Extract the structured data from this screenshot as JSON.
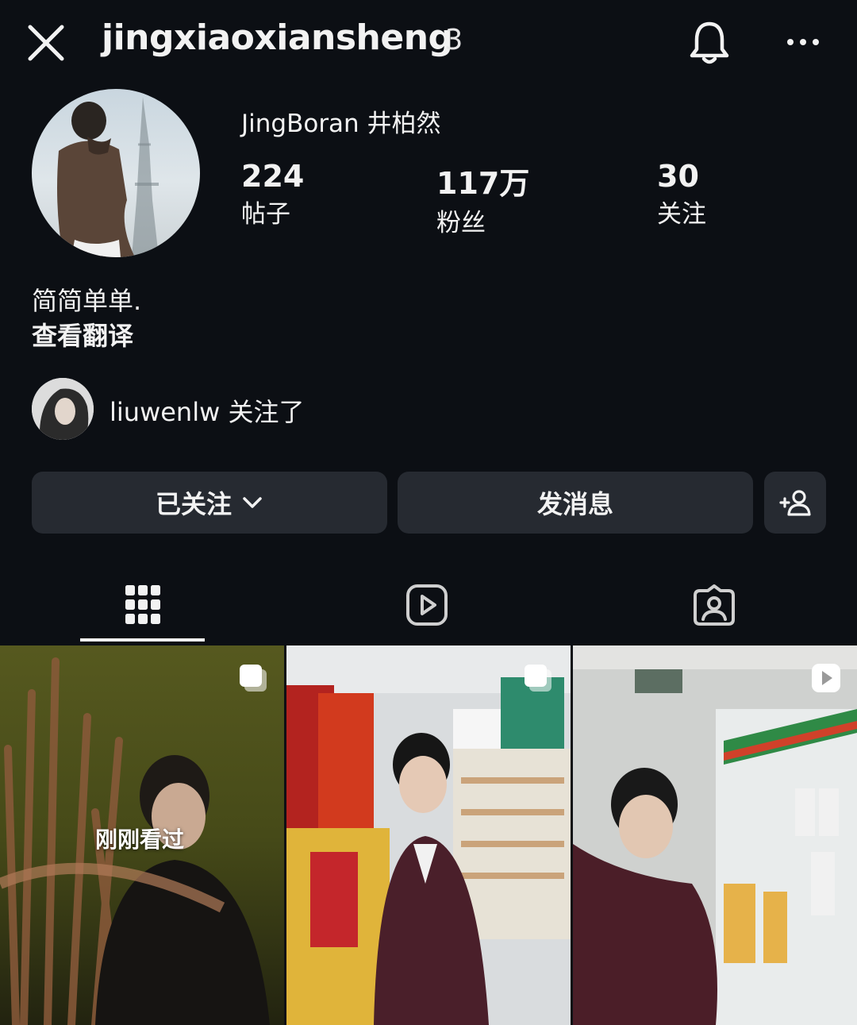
{
  "header": {
    "username": "jingxiaoxiansheng",
    "username_suffix": "3",
    "icons": [
      "close-icon",
      "bell-icon",
      "more-icon"
    ]
  },
  "profile": {
    "display_name": "JingBoran 井柏然",
    "stats": [
      {
        "value": "224",
        "label": "帖子"
      },
      {
        "value": "117万",
        "label": "粉丝"
      },
      {
        "value": "30",
        "label": "关注"
      }
    ],
    "bio": "简简单单.",
    "translate_label": "查看翻译",
    "followed_by": "liuwenlw 关注了"
  },
  "actions": {
    "following_label": "已关注",
    "message_label": "发消息",
    "icons": [
      "chevron-down-icon",
      "add-person-icon"
    ]
  },
  "tabs": [
    {
      "icon": "grid-icon",
      "active": true
    },
    {
      "icon": "reels-icon",
      "active": false
    },
    {
      "icon": "tagged-icon",
      "active": false
    }
  ],
  "posts": [
    {
      "overlay_text": "刚刚看过",
      "badge": "carousel-icon"
    },
    {
      "overlay_text": "",
      "badge": "carousel-icon"
    },
    {
      "overlay_text": "",
      "badge": "reel-badge-icon"
    }
  ],
  "colors": {
    "background": "#0c0f14",
    "button": "#262a31",
    "text": "#f2f2f2"
  }
}
